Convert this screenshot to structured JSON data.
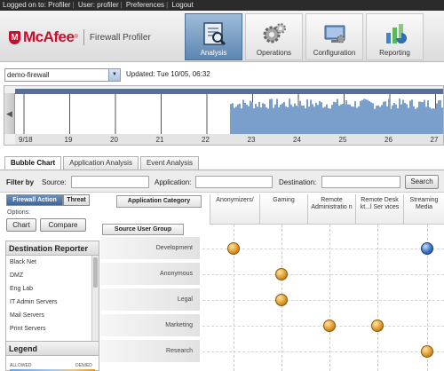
{
  "topbar": {
    "logged_on": "Logged on to: Profiler",
    "user": "User: profiler",
    "preferences": "Preferences",
    "logout": "Logout"
  },
  "brand": {
    "shield_letter": "M",
    "name": "McAfee",
    "product": "Firewall Profiler"
  },
  "nav": {
    "tabs": [
      {
        "label": "Analysis",
        "icon": "analysis-icon",
        "active": true
      },
      {
        "label": "Operations",
        "icon": "gears-icon",
        "active": false
      },
      {
        "label": "Configuration",
        "icon": "configuration-icon",
        "active": false
      },
      {
        "label": "Reporting",
        "icon": "reporting-chart-icon",
        "active": false
      }
    ]
  },
  "firewall": {
    "selected": "demo-firewall",
    "updated": "Updated: Tue 10/05, 06:32"
  },
  "timeline": {
    "ticks": [
      "9/18",
      "19",
      "20",
      "21",
      "22",
      "23",
      "24",
      "25",
      "26",
      "27"
    ],
    "bar_color": "#7b9fcb",
    "band_color": "#5a6e93"
  },
  "tabs": [
    "Bubble Chart",
    "Application Analysis",
    "Event Analysis"
  ],
  "filter": {
    "title": "Filter by",
    "source": "Source:",
    "application": "Application:",
    "destination": "Destination:",
    "search": "Search"
  },
  "toggle": {
    "firewall_action": "Firewall Action",
    "threat": "Threat"
  },
  "options": {
    "label": "Options:",
    "chart": "Chart",
    "compare": "Compare"
  },
  "app_category_button": "Application Category",
  "source_user_group_button": "Source User Group",
  "columns": [
    "Anonymizers/",
    "Gaming",
    "Remote Administratio n",
    "Remote Desk kt...l Ser vices",
    "Streaming Media"
  ],
  "rows": [
    "Development",
    "Anonymous",
    "Legal",
    "Marketing",
    "Research"
  ],
  "bubbles": [
    {
      "row": "Development",
      "column": "Anonymizers/",
      "color": "orange"
    },
    {
      "row": "Development",
      "column": "Streaming Media",
      "color": "blue"
    },
    {
      "row": "Anonymous",
      "column": "Gaming",
      "color": "orange"
    },
    {
      "row": "Legal",
      "column": "Gaming",
      "color": "orange"
    },
    {
      "row": "Marketing",
      "column": "Remote Administratio n",
      "color": "orange"
    },
    {
      "row": "Marketing",
      "column": "Remote Desk kt...l Ser vices",
      "color": "orange"
    },
    {
      "row": "Research",
      "column": "Streaming Media",
      "color": "orange"
    }
  ],
  "destination_reporter": {
    "title": "Destination Reporter",
    "items": [
      "Black Net",
      "DMZ",
      "Eng Lab",
      "IT Admin Servers",
      "Mail Servers",
      "Print Servers"
    ]
  },
  "legend": {
    "title": "Legend",
    "allowed": "ALLOWED",
    "denied": "DENIED"
  }
}
